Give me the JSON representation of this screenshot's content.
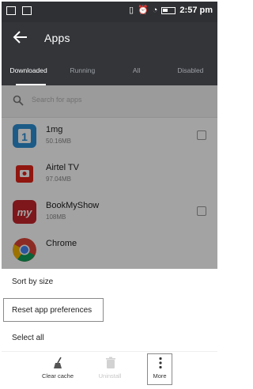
{
  "status_bar": {
    "time": "2:57 pm"
  },
  "app_bar": {
    "title": "Apps"
  },
  "tabs": [
    {
      "label": "Downloaded",
      "active": true
    },
    {
      "label": "Running",
      "active": false
    },
    {
      "label": "All",
      "active": false
    },
    {
      "label": "Disabled",
      "active": false
    }
  ],
  "search": {
    "placeholder": "Search for apps"
  },
  "apps": [
    {
      "name": "1mg",
      "size": "50.16MB",
      "icon": "1mg-icon",
      "color": "#2d8fd4"
    },
    {
      "name": "Airtel TV",
      "size": "97.04MB",
      "icon": "airtel-tv-icon",
      "color": "#e2231a"
    },
    {
      "name": "BookMyShow",
      "size": "108MB",
      "icon": "bookmyshow-icon",
      "color": "#c4242b"
    },
    {
      "name": "Chrome",
      "size": "",
      "icon": "chrome-icon",
      "color": "#4285f4"
    }
  ],
  "menu": {
    "sort": "Sort by size",
    "reset": "Reset app preferences",
    "select_all": "Select all"
  },
  "bottom_bar": {
    "clear_cache": "Clear cache",
    "uninstall": "Uninstall",
    "more": "More"
  },
  "colors": {
    "status_bar": "#2f3033",
    "app_bar": "#333539",
    "accent_active_tab": "#ffffff"
  }
}
